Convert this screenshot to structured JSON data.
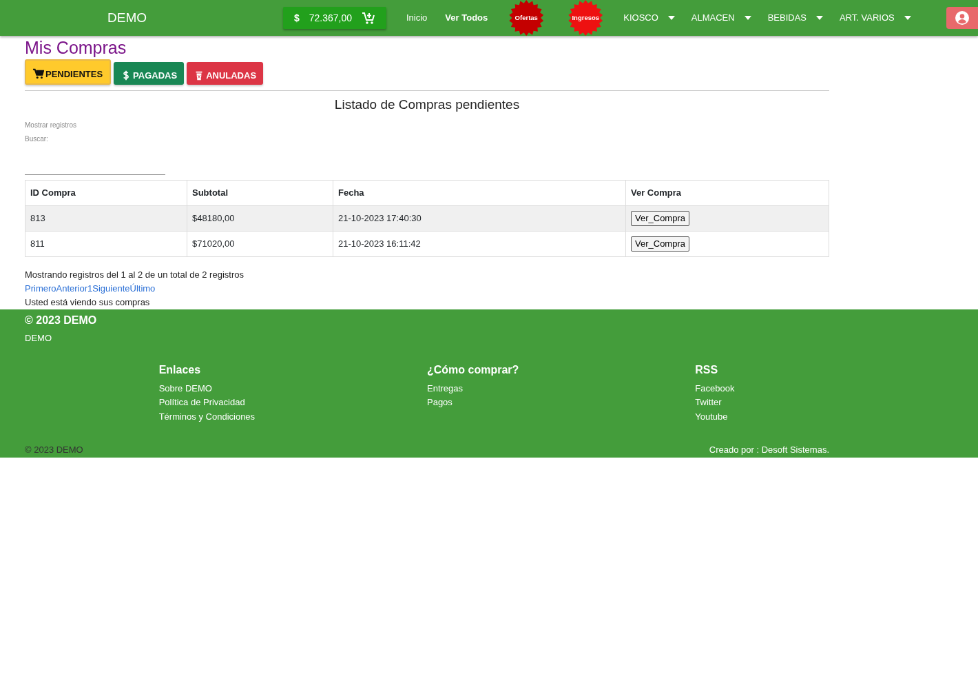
{
  "navbar": {
    "brand": "DEMO",
    "balance": {
      "currency": "$",
      "amount": "72.367,00"
    },
    "links": [
      {
        "label": "Inicio",
        "bold": false
      },
      {
        "label": "Ver Todos",
        "bold": true
      }
    ],
    "badges": [
      {
        "label": "Ofertas",
        "color": "#c40000"
      },
      {
        "label": "Ingresos",
        "color": "#ee1111"
      }
    ],
    "dropdowns": [
      "KIOSCO",
      "ALMACEN",
      "BEBIDAS",
      "ART. VARIOS"
    ]
  },
  "page_title": "Mis Compras",
  "tabs": [
    {
      "label": "PENDIENTES",
      "kind": "cart",
      "color": "#ffca2c",
      "selected": true
    },
    {
      "label": "PAGADAS",
      "kind": "dollar",
      "color": "#198754",
      "selected": false
    },
    {
      "label": "ANULADAS",
      "kind": "trash",
      "color": "#dc3545",
      "selected": false
    }
  ],
  "list_title": "Listado de Compras pendientes",
  "length_label": "Mostrar registros",
  "search_label": "Buscar:",
  "table": {
    "columns": [
      "ID Compra",
      "Subtotal",
      "Fecha",
      "Ver Compra"
    ],
    "rows": [
      {
        "id": "813",
        "subtotal": "$48180,00",
        "date": "21-10-2023 17:40:30",
        "action": "Ver_Compra"
      },
      {
        "id": "811",
        "subtotal": "$71020,00",
        "date": "21-10-2023 16:11:42",
        "action": "Ver_Compra"
      }
    ]
  },
  "info": "Mostrando registros del 1 al 2 de un total de 2 registros",
  "pagination": [
    "Primero",
    "Anterior",
    "1",
    "Siguiente",
    "Último"
  ],
  "note": "Usted está viendo sus compras",
  "footer": {
    "title": "© 2023 DEMO",
    "subtitle": "DEMO",
    "columns": [
      {
        "heading": "Enlaces",
        "links": [
          "Sobre DEMO",
          "Política de Privacidad",
          "Términos y Condiciones"
        ]
      },
      {
        "heading": "¿Cómo comprar?",
        "links": [
          "Entregas",
          "Pagos"
        ]
      },
      {
        "heading": "RSS",
        "links": [
          "Facebook",
          "Twitter",
          "Youtube"
        ]
      }
    ],
    "copyright": "© 2023 DEMO",
    "credit": "Creado por : Desoft Sistemas."
  }
}
